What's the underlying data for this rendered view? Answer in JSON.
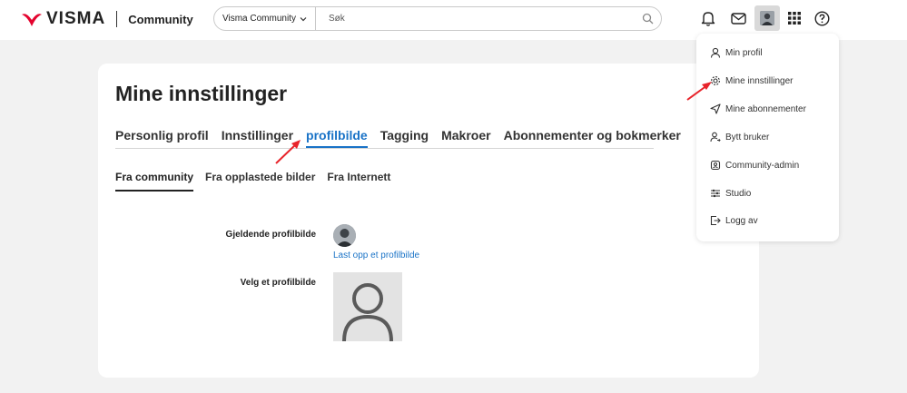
{
  "header": {
    "brand": "VISMA",
    "section": "Community",
    "search": {
      "scope": "Visma Community",
      "placeholder": "Søk"
    },
    "icons": [
      "notifications-bell-icon",
      "mail-icon",
      "user-avatar",
      "apps-grid-icon",
      "help-icon"
    ]
  },
  "page": {
    "title": "Mine innstillinger",
    "tabs": [
      {
        "label": "Personlig profil"
      },
      {
        "label": "Innstillinger"
      },
      {
        "label": "profilbilde",
        "active": true
      },
      {
        "label": "Tagging"
      },
      {
        "label": "Makroer"
      },
      {
        "label": "Abonnementer og bokmerker"
      }
    ],
    "subtabs": [
      {
        "label": "Fra community",
        "active": true
      },
      {
        "label": "Fra opplastede bilder"
      },
      {
        "label": "Fra Internett"
      }
    ],
    "current_picture_label": "Gjeldende profilbilde",
    "upload_link": "Last opp et profilbilde",
    "choose_picture_label": "Velg et profilbilde"
  },
  "user_menu": {
    "items": [
      {
        "label": "Min profil",
        "icon": "user-icon"
      },
      {
        "label": "Mine innstillinger",
        "icon": "gear-icon"
      },
      {
        "label": "Mine abonnementer",
        "icon": "paper-plane-icon"
      },
      {
        "label": "Bytt bruker",
        "icon": "switch-user-icon"
      },
      {
        "label": "Community-admin",
        "icon": "admin-icon"
      },
      {
        "label": "Studio",
        "icon": "sliders-icon"
      },
      {
        "label": "Logg av",
        "icon": "logout-icon"
      }
    ]
  },
  "colors": {
    "brand_red": "#e4032e",
    "link_blue": "#1a73c7",
    "annotation_red": "#e8242b"
  }
}
